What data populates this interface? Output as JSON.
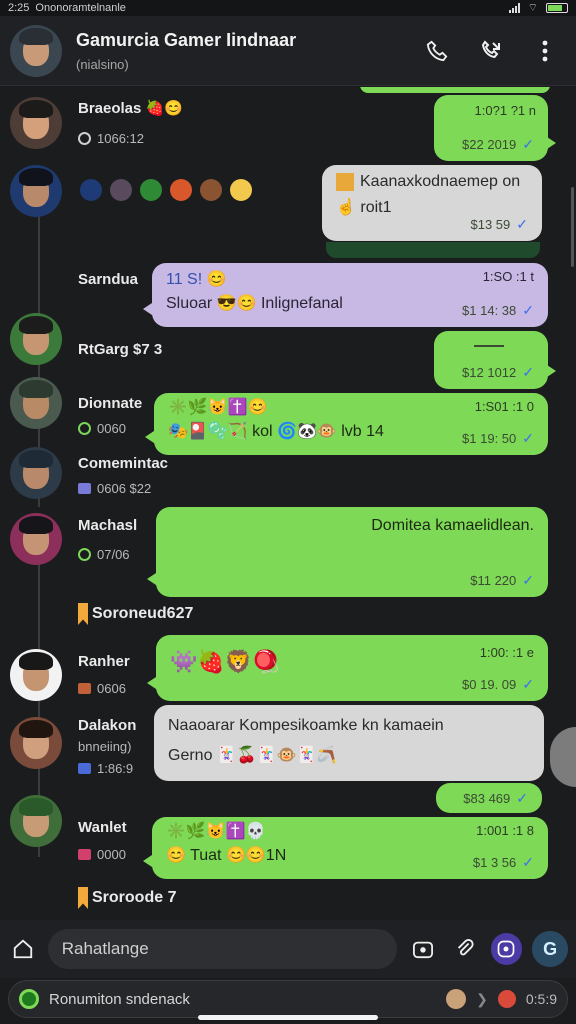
{
  "status": {
    "time": "2:25",
    "carrier": "Ononoramtelnanle"
  },
  "header": {
    "title": "Gamurcia Gamer Iindnaar",
    "subtitle": "(nialsino)"
  },
  "messages": [
    {
      "sender": "Braeolas",
      "sender_emoji": "🍓😊",
      "meta": "1066:12",
      "bubble_time": "1:0?1 ?1 n",
      "bubble_stamp": "$22 2019"
    },
    {
      "emojis": [
        "🌑",
        "🫧",
        "🐸",
        "🎭",
        "🦔",
        "🙂"
      ],
      "bubble_line1": "Kaanaxkodnaemep on",
      "bubble_line2": "roit1",
      "bubble_stamp": "$13 59"
    },
    {
      "sender": "Sarndua",
      "bubble_head": "11 S! 😊",
      "bubble_time": "1:SO :1 t",
      "bubble_text": "Sluoar 😎😊 Inlignefanal",
      "bubble_stamp": "$1 14: 38"
    },
    {
      "sender": "RtGarg $7 3",
      "bubble_stamp": "$12 1012"
    },
    {
      "sender": "Dionnate",
      "meta": "0060",
      "bubble_head": "✳️🌿😺✝️😊",
      "bubble_time": "1:S01 :1 0",
      "bubble_text": "🎭🎴🫧🏹 kol 🌀🐼🐵 lvb 14",
      "bubble_stamp": "$1 19: 50"
    },
    {
      "sender": "Comemintac",
      "meta": "0606 $22"
    },
    {
      "sender": "Machasl",
      "meta": "07/06",
      "bubble_text": "Domitea kamaelidlean.",
      "bubble_stamp": "$11 220"
    },
    {
      "pin": "Soroneud627"
    },
    {
      "sender": "Ranher",
      "meta": "0606",
      "bubble_time": "1:00: :1 e",
      "bubble_text": "👾🍓🦁🪀",
      "bubble_stamp": "$0 19. 09"
    },
    {
      "sender": "Dalakon",
      "meta_top": "bnneiing)",
      "meta": "1:86:9",
      "bubble_line1": "Naaoarar Kompesikoamke kn kamaein",
      "bubble_line2": "Gerno 🃏🍒🃏🐵🃏🪃",
      "bubble_stamp": "$83 469"
    },
    {
      "sender": "Wanlet",
      "meta": "0000",
      "bubble_head": "✳️🌿😺✝️💀",
      "bubble_time": "1:001 :1 8",
      "bubble_text": "😊 Tuat 😊😊1N",
      "bubble_stamp": "$1 3 56"
    },
    {
      "pin": "Sroroode 7"
    }
  ],
  "input": {
    "placeholder": "Rahatlange"
  },
  "notification": {
    "text": "Ronumiton sndenack",
    "right": "0:5:9"
  },
  "colors": {
    "bubble_green": "#7ed957",
    "bubble_purple": "#c8b9e4",
    "background": "#1b1c1e",
    "read_check": "#3d6ff0"
  },
  "icons": [
    "phone-icon",
    "video-call-icon",
    "more-vert-icon",
    "home-icon",
    "camera-icon",
    "attach-icon",
    "sticker-icon",
    "send-icon"
  ]
}
